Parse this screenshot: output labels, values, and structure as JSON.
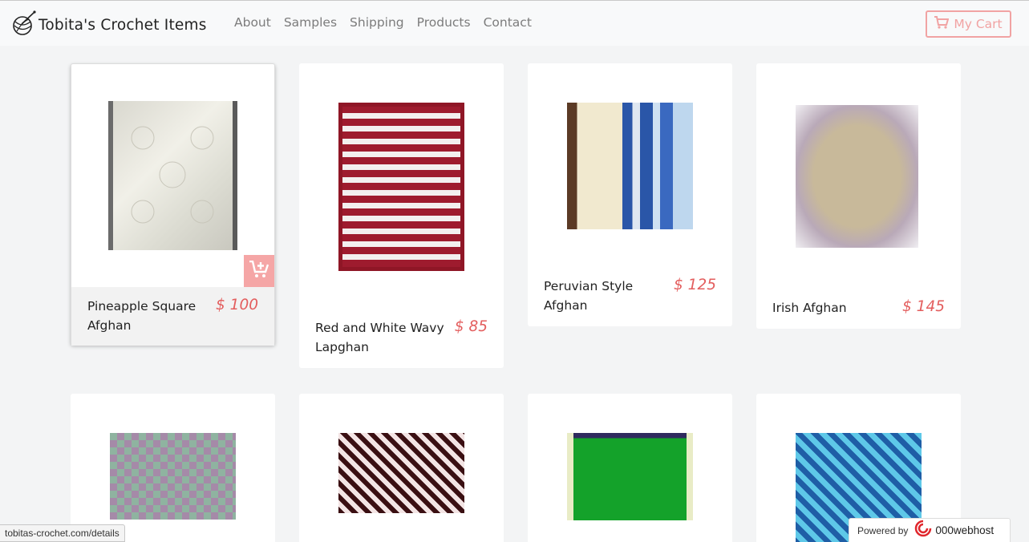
{
  "navbar": {
    "brand": "Tobita's Crochet Items",
    "links": [
      "About",
      "Samples",
      "Shipping",
      "Products",
      "Contact"
    ],
    "cart_label": "My Cart"
  },
  "products": [
    {
      "name_line1": "Pineapple Square",
      "name_line2": "Afghan",
      "price": "$ 100"
    },
    {
      "name_line1": "Red and White Wavy",
      "name_line2": "Lapghan",
      "price": "$ 85"
    },
    {
      "name_line1": "Peruvian Style",
      "name_line2": "Afghan",
      "price": "$ 125"
    },
    {
      "name_line1": "Irish Afghan",
      "name_line2": "",
      "price": "$ 145"
    }
  ],
  "status_url": "tobitas-crochet.com/details",
  "powered": {
    "label": "Powered by",
    "host": "000webhost"
  },
  "colors": {
    "accent": "#e35d5d",
    "cart_border": "#f1a3a3",
    "background": "#f3f4f5"
  }
}
